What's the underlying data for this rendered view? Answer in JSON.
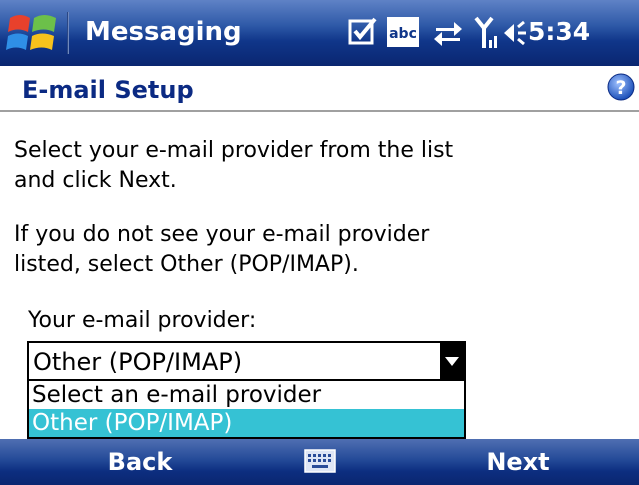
{
  "titlebar": {
    "app_title": "Messaging",
    "clock": "5:34",
    "icons": [
      "start-flag-icon",
      "checkbox-icon",
      "abc-icon",
      "connectivity-arrows-icon",
      "signal-icon",
      "volume-icon"
    ]
  },
  "page": {
    "title": "E-mail Setup",
    "help_icon": "help-icon"
  },
  "body": {
    "instruction_1": "Select your e-mail provider from the list\nand click Next.",
    "instruction_2": "If you do not see your e-mail provider\nlisted, select Other (POP/IMAP).",
    "provider_label": "Your e-mail provider:"
  },
  "provider_select": {
    "selected_value": "Other (POP/IMAP)",
    "options": [
      {
        "label": "Select an e-mail provider",
        "highlighted": false
      },
      {
        "label": "Other (POP/IMAP)",
        "highlighted": true
      }
    ]
  },
  "softkeys": {
    "left": "Back",
    "right": "Next",
    "center_icon": "keyboard-icon"
  },
  "colors": {
    "title_blue": "#0b2a83",
    "highlight": "#35c2d4",
    "bar_dark": "#0a2670"
  }
}
